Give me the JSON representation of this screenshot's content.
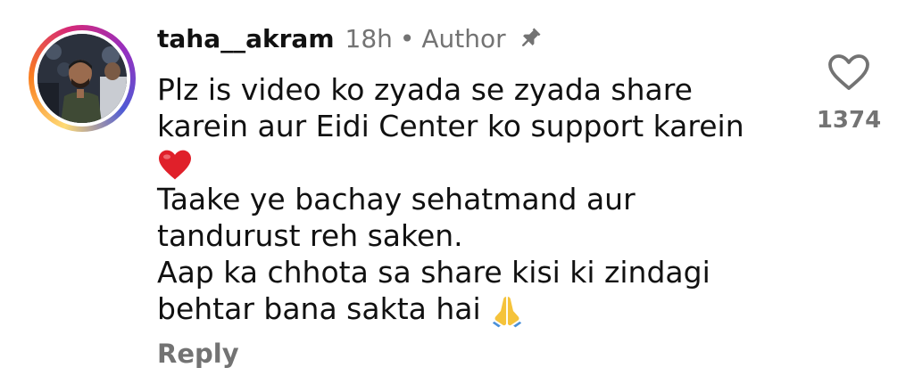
{
  "comment": {
    "username": "taha__akram",
    "time": "18h",
    "separator": "•",
    "badge": "Author",
    "pin_icon": "pin-icon",
    "lines": [
      "Plz is video ko zyada se zyada share",
      "karein aur Eidi Center ko support karein",
      "Taake ye bachay sehatmand aur",
      "tandurust reh saken.",
      "Aap ka chhota sa share kisi ki zindagi",
      "behtar bana sakta hai"
    ],
    "emojis": [
      "red-heart-emoji",
      "folded-hands-emoji"
    ],
    "reply_label": "Reply",
    "likes": "1374",
    "like_icon": "heart-outline-icon"
  },
  "colors": {
    "text_primary": "#111111",
    "text_secondary": "#737373",
    "heart_red": "#e0202a",
    "folded_hands": "#f5c33b"
  }
}
